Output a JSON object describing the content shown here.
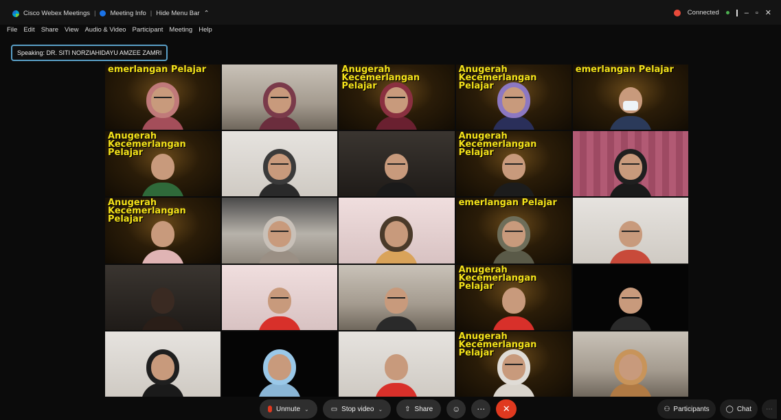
{
  "titlebar": {
    "app_title": "Cisco Webex Meetings",
    "meeting_info": "Meeting Info",
    "hide_menu": "Hide Menu Bar",
    "connection_status": "Connected"
  },
  "menu": [
    "File",
    "Edit",
    "Share",
    "View",
    "Audio & Video",
    "Participant",
    "Meeting",
    "Help"
  ],
  "speaking_label": "Speaking: DR. SITI NORZIAHIDAYU AMZEE ZAMRI",
  "overlay_texts": {
    "t1": "emerlangan Pelajar",
    "t3": "Anugerah Kecemerlangan Pelajar",
    "t4": "Anugerah Kecemerlangan Pelajar",
    "t5": "emerlangan Pelajar",
    "t6": "Anugerah Kecemerlangan Pelajar",
    "t9": "Anugerah Kecemerlangan Pelajar",
    "t11": "Anugerah Kecemerlangan Pelajar",
    "t14": "emerlangan Pelajar",
    "t19": "Anugerah Kecemerlangan Pelajar",
    "t24": "Anugerah Kecemerlangan Pelajar"
  },
  "controls": {
    "unmute": "Unmute",
    "stop_video": "Stop video",
    "share": "Share",
    "participants": "Participants",
    "chat": "Chat"
  },
  "colors": {
    "end_button": "#e0391f",
    "speaking_border": "#5aa0c8",
    "overlay_text": "#f4e21a"
  }
}
